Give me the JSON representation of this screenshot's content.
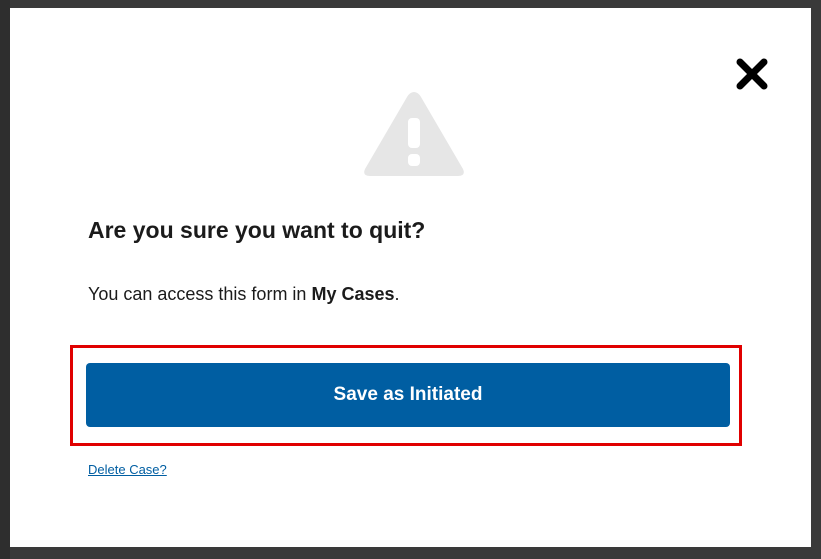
{
  "dialog": {
    "title": "Are you sure you want to quit?",
    "message_prefix": "You can access this form in ",
    "message_bold": "My Cases",
    "message_suffix": ".",
    "primary_button": "Save as Initiated",
    "delete_link": "Delete Case?",
    "close_icon": "close-icon",
    "warning_icon": "warning-triangle-icon"
  },
  "colors": {
    "primary": "#005ea2",
    "highlight": "#e00000",
    "icon_gray": "#e6e6e6",
    "text": "#1b1b1b"
  }
}
